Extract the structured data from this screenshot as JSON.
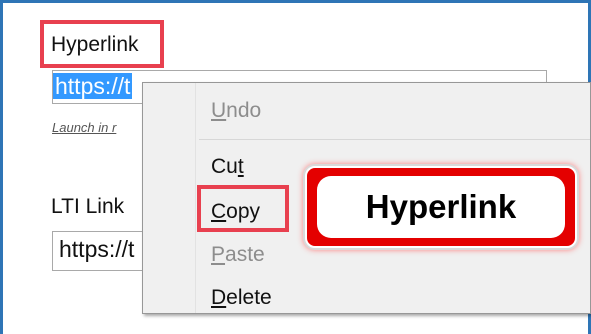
{
  "hyperlink_label": "Hyperlink",
  "hyperlink_field": {
    "value_visible": "https://t"
  },
  "launch_link": "Launch in r",
  "lti_label": "LTI Link",
  "lti_field": {
    "value_visible": "https://t"
  },
  "context_menu": {
    "items": [
      {
        "label": "Undo",
        "accel": "U",
        "rest": "ndo",
        "enabled": false
      },
      {
        "label": "Cut",
        "accel_prefix": "Cu",
        "accel": "t",
        "enabled": true
      },
      {
        "label": "Copy",
        "accel": "C",
        "rest": "opy",
        "enabled": true
      },
      {
        "label": "Paste",
        "accel": "P",
        "rest": "aste",
        "enabled": false
      },
      {
        "label": "Delete",
        "accel": "D",
        "rest": "elete",
        "enabled": true
      }
    ]
  },
  "badge_text": "Hyperlink",
  "colors": {
    "frame_blue": "#2e75b6",
    "highlight_red": "#e8404f",
    "selection_blue": "#3399ff",
    "badge_red": "#e40000"
  }
}
